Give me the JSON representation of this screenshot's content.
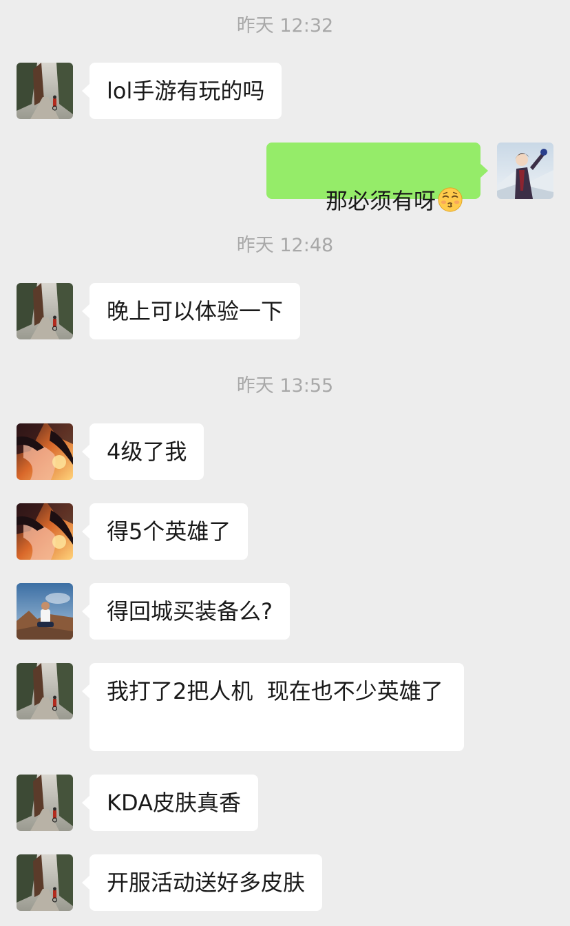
{
  "colors": {
    "background": "#ededed",
    "bubble_received": "#ffffff",
    "bubble_sent": "#95ec69",
    "timestamp_text": "#a8a8a8"
  },
  "timestamps": [
    "昨天 12:32",
    "昨天 12:48",
    "昨天 13:55"
  ],
  "messages": [
    {
      "side": "left",
      "avatar": "forest-road-cyclist-avatar",
      "text": "lol手游有玩的吗"
    },
    {
      "side": "right",
      "avatar": "anime-boy-waving-avatar",
      "text": "那必须有呀",
      "emoji": "kissing-face-with-closed-eyes-emoji"
    },
    {
      "side": "left",
      "avatar": "forest-road-cyclist-avatar",
      "text": "晚上可以体验一下"
    },
    {
      "side": "left",
      "avatar": "anime-fiery-girl-avatar",
      "text": "4级了我"
    },
    {
      "side": "left",
      "avatar": "anime-fiery-girl-avatar",
      "text": "得5个英雄了"
    },
    {
      "side": "left",
      "avatar": "man-sitting-on-rocks-avatar",
      "text": "得回城买装备么?"
    },
    {
      "side": "left",
      "avatar": "forest-road-cyclist-avatar",
      "text": "我打了2把人机  现在也不少英雄了"
    },
    {
      "side": "left",
      "avatar": "forest-road-cyclist-avatar",
      "text": "KDA皮肤真香"
    },
    {
      "side": "left",
      "avatar": "forest-road-cyclist-avatar",
      "text": "开服活动送好多皮肤"
    }
  ]
}
